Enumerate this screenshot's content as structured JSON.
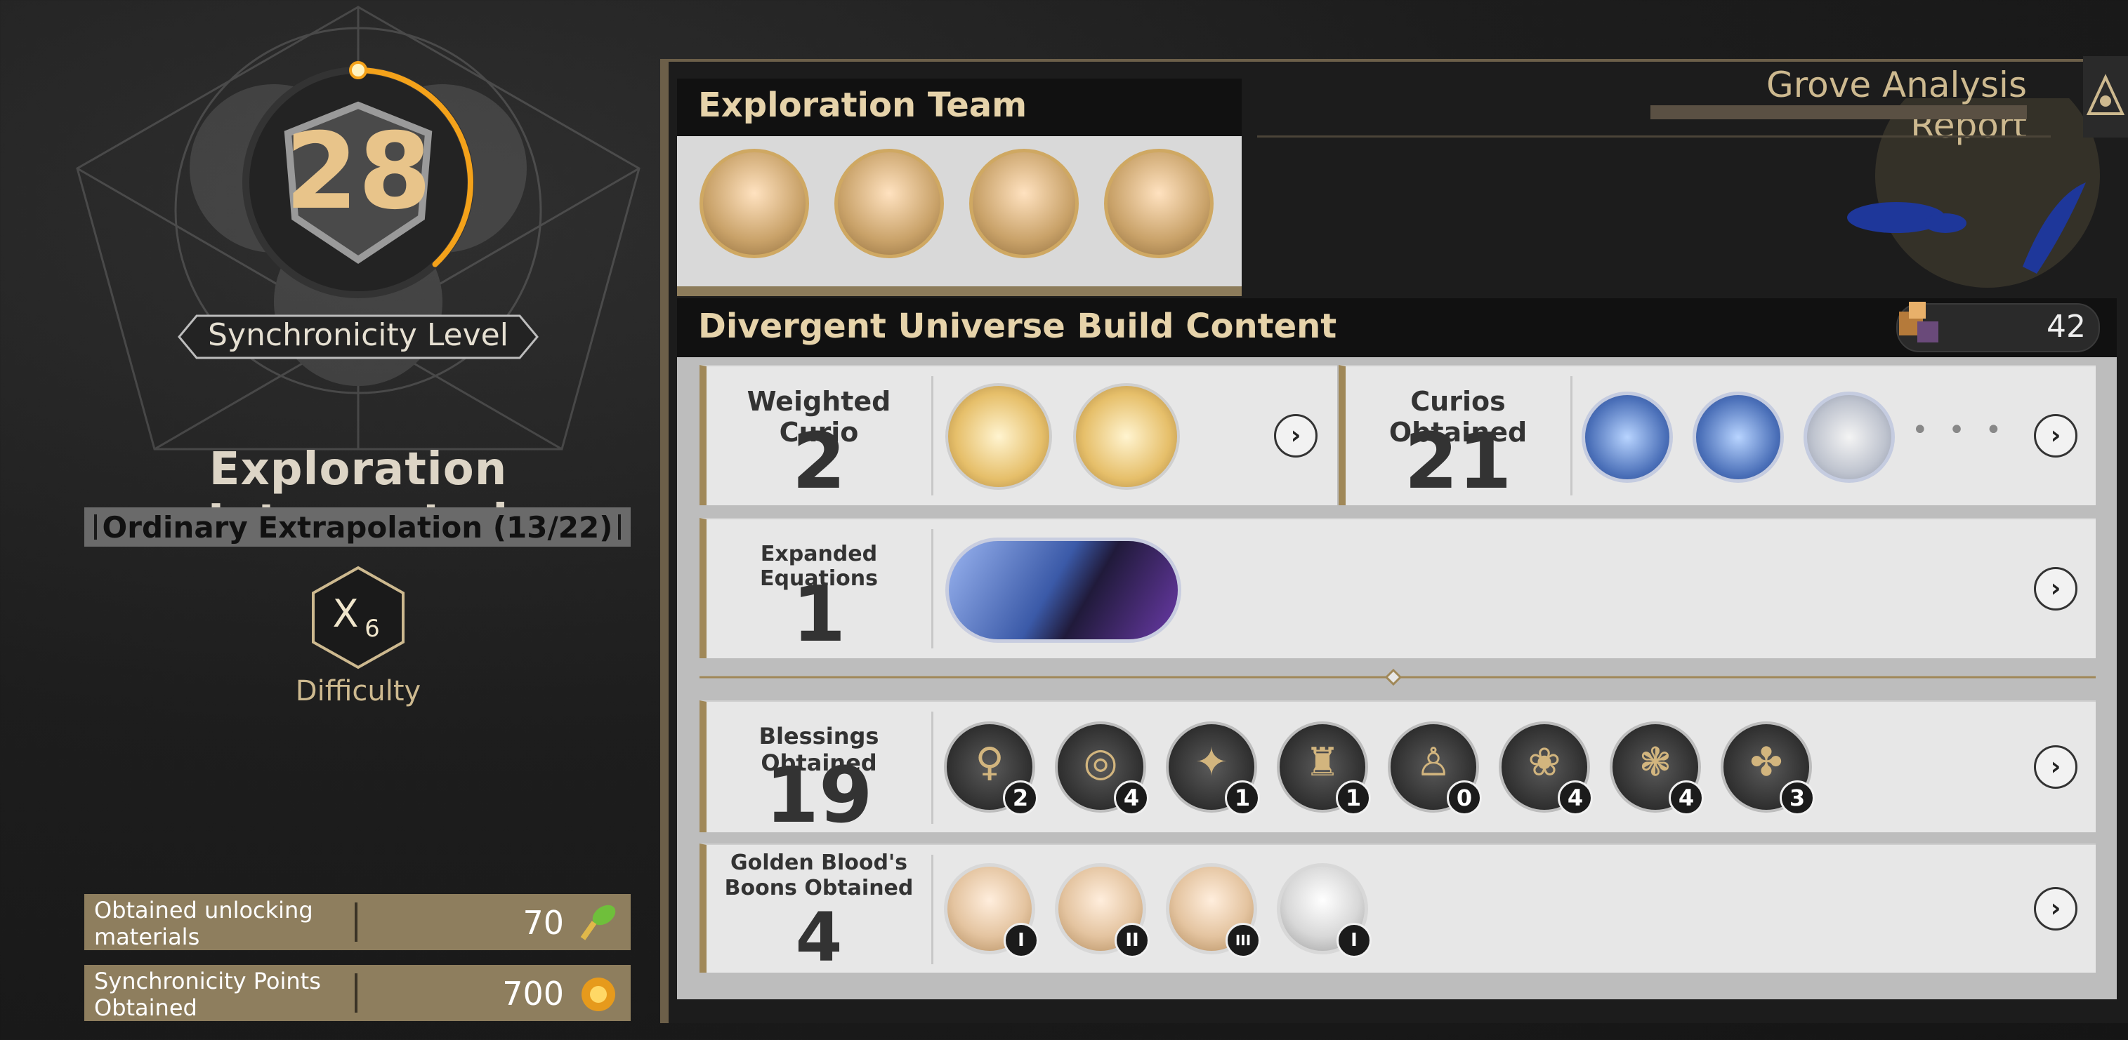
{
  "left": {
    "synchronicity_level": "28",
    "synchronicity_label": "Synchronicity Level",
    "synchronicity_progress": 0.38,
    "status_title": "Exploration Interrupted",
    "mode": "Ordinary Extrapolation (13/22)",
    "difficulty_symbol": "X",
    "difficulty_value": "6",
    "difficulty_label": "Difficulty",
    "materials": [
      {
        "label": "Obtained unlocking materials",
        "value": "70",
        "icon": "leaf-key-icon"
      },
      {
        "label": "Synchronicity Points Obtained",
        "value": "700",
        "icon": "gold-orb-icon"
      }
    ]
  },
  "right": {
    "report_title": "Grove Analysis Report",
    "team": {
      "title": "Exploration Team",
      "members": [
        "character-1",
        "character-2",
        "character-3",
        "character-4"
      ]
    },
    "build": {
      "title": "Divergent Universe Build Content",
      "cube_count": "42",
      "weighted_curio": {
        "label": "Weighted Curio",
        "count": "2"
      },
      "curios_obtained": {
        "label": "Curios Obtained",
        "count": "21",
        "more": "• • •"
      },
      "expanded_equations": {
        "label": "Expanded Equations",
        "count": "1"
      },
      "blessings": {
        "label": "Blessings Obtained",
        "count": "19",
        "items": [
          {
            "symbol": "♀",
            "count": "2"
          },
          {
            "symbol": "◎",
            "count": "4"
          },
          {
            "symbol": "✦",
            "count": "1"
          },
          {
            "symbol": "♜",
            "count": "1"
          },
          {
            "symbol": "♙",
            "count": "0"
          },
          {
            "symbol": "❀",
            "count": "4"
          },
          {
            "symbol": "❃",
            "count": "4"
          },
          {
            "symbol": "✤",
            "count": "3"
          }
        ]
      },
      "golden_blood": {
        "label_line1": "Golden Blood's",
        "label_line2": "Boons Obtained",
        "count": "4",
        "boons": [
          "I",
          "II",
          "III",
          "I"
        ]
      }
    }
  },
  "colors": {
    "gold": "#e8c48a",
    "accent_orange": "#f4a21a",
    "card_border": "#a08858"
  }
}
